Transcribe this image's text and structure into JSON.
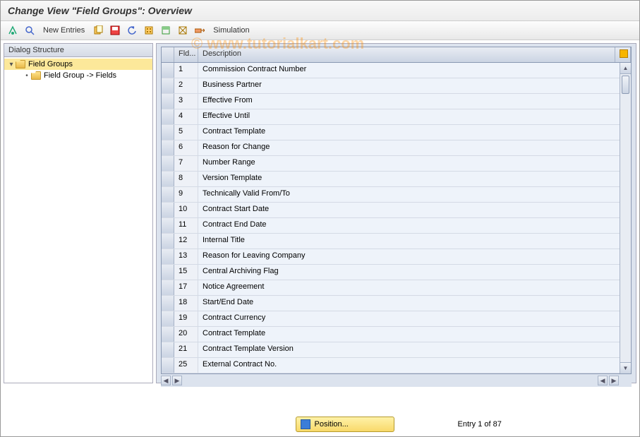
{
  "title": "Change View \"Field Groups\": Overview",
  "toolbar": {
    "new_entries": "New Entries",
    "simulation": "Simulation"
  },
  "sidebar": {
    "header": "Dialog Structure",
    "items": [
      {
        "label": "Field Groups"
      },
      {
        "label": "Field Group -> Fields"
      }
    ]
  },
  "table": {
    "headers": {
      "fld": "Fld...",
      "description": "Description"
    },
    "rows": [
      {
        "fld": "1",
        "desc": "Commission Contract Number"
      },
      {
        "fld": "2",
        "desc": "Business Partner"
      },
      {
        "fld": "3",
        "desc": "Effective From"
      },
      {
        "fld": "4",
        "desc": "Effective Until"
      },
      {
        "fld": "5",
        "desc": "Contract Template"
      },
      {
        "fld": "6",
        "desc": "Reason for Change"
      },
      {
        "fld": "7",
        "desc": "Number Range"
      },
      {
        "fld": "8",
        "desc": "Version Template"
      },
      {
        "fld": "9",
        "desc": "Technically Valid From/To"
      },
      {
        "fld": "10",
        "desc": "Contract Start Date"
      },
      {
        "fld": "11",
        "desc": "Contract End Date"
      },
      {
        "fld": "12",
        "desc": "Internal Title"
      },
      {
        "fld": "13",
        "desc": "Reason for Leaving Company"
      },
      {
        "fld": "15",
        "desc": "Central Archiving Flag"
      },
      {
        "fld": "17",
        "desc": "Notice Agreement"
      },
      {
        "fld": "18",
        "desc": "Start/End Date"
      },
      {
        "fld": "19",
        "desc": "Contract Currency"
      },
      {
        "fld": "20",
        "desc": "Contract Template"
      },
      {
        "fld": "21",
        "desc": "Contract Template Version"
      },
      {
        "fld": "25",
        "desc": "External Contract No."
      }
    ]
  },
  "footer": {
    "position_label": "Position...",
    "entry_count": "Entry 1 of 87"
  },
  "watermark": "© www.tutorialkart.com"
}
